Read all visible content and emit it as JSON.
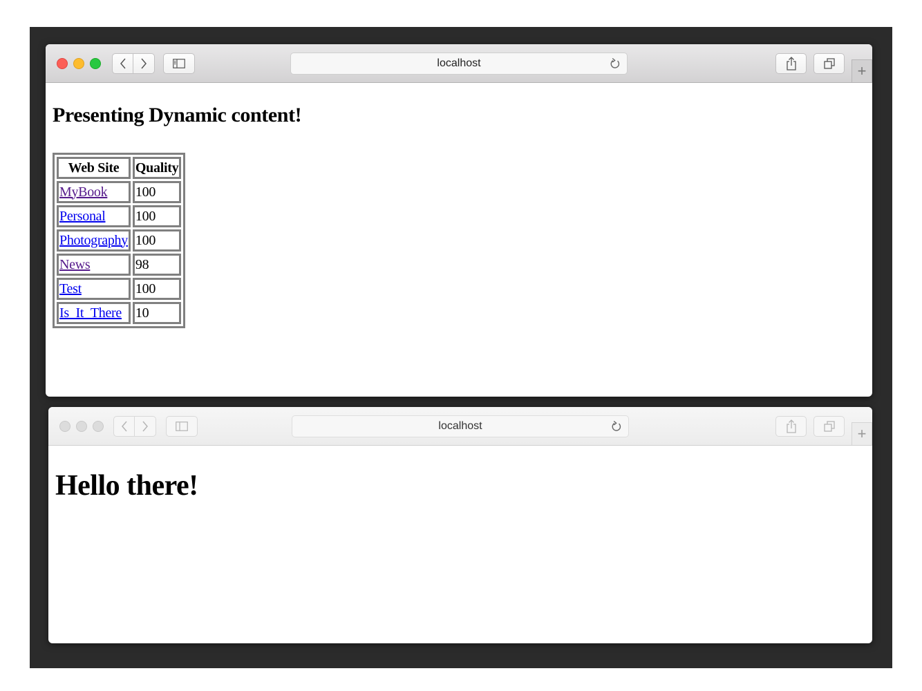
{
  "top_window": {
    "address": "localhost",
    "heading": "Presenting Dynamic content!",
    "table": {
      "headers": [
        "Web Site",
        "Quality"
      ],
      "rows": [
        {
          "site": "MyBook",
          "quality": "100",
          "visited": true
        },
        {
          "site": "Personal",
          "quality": "100",
          "visited": false
        },
        {
          "site": "Photography",
          "quality": "100",
          "visited": false
        },
        {
          "site": "News",
          "quality": "98",
          "visited": true
        },
        {
          "site": "Test",
          "quality": "100",
          "visited": false
        },
        {
          "site": "Is_It_There",
          "quality": "10",
          "visited": false
        }
      ]
    }
  },
  "bottom_window": {
    "address": "localhost",
    "heading": "Hello there!"
  },
  "toolbar": {
    "new_tab_label": "+"
  },
  "icons": {
    "back": "chevron-left-icon",
    "forward": "chevron-right-icon",
    "sidebar": "sidebar-icon",
    "reload": "reload-icon",
    "share": "share-icon",
    "tabs": "tabs-overview-icon"
  },
  "colors": {
    "close": "#fc5f57",
    "minimize": "#fdbc2e",
    "zoom": "#28c840",
    "link": "#0000ee",
    "link_visited": "#551a8b",
    "table_border": "#808080",
    "desktop": "#2b2b2b"
  }
}
